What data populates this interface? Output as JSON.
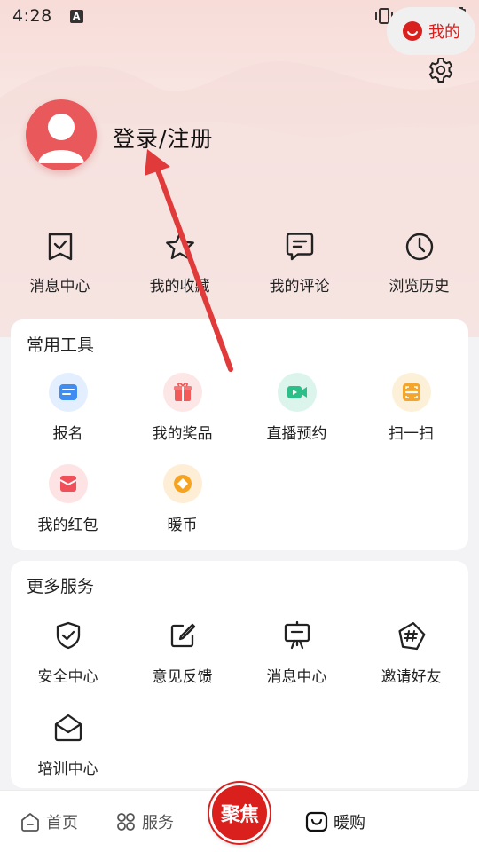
{
  "status": {
    "time": "4:28",
    "indicator": "A"
  },
  "profile": {
    "login_label": "登录/注册"
  },
  "quick": [
    {
      "label": "消息中心",
      "icon": "message-check-icon"
    },
    {
      "label": "我的收藏",
      "icon": "star-icon"
    },
    {
      "label": "我的评论",
      "icon": "comment-icon"
    },
    {
      "label": "浏览历史",
      "icon": "clock-icon"
    }
  ],
  "tools": {
    "title": "常用工具",
    "items": [
      {
        "label": "报名",
        "icon": "signup-icon",
        "color": "#3f8df0"
      },
      {
        "label": "我的奖品",
        "icon": "gift-icon",
        "color": "#f25a5a"
      },
      {
        "label": "直播预约",
        "icon": "video-icon",
        "color": "#2bbf8a"
      },
      {
        "label": "扫一扫",
        "icon": "scan-icon",
        "color": "#f4a52b"
      },
      {
        "label": "我的红包",
        "icon": "red-packet-icon",
        "color": "#f0505a"
      },
      {
        "label": "暖币",
        "icon": "coin-icon",
        "color": "#f6a321"
      }
    ]
  },
  "services": {
    "title": "更多服务",
    "items": [
      {
        "label": "安全中心",
        "icon": "shield-check-icon"
      },
      {
        "label": "意见反馈",
        "icon": "edit-icon"
      },
      {
        "label": "消息中心",
        "icon": "easel-icon"
      },
      {
        "label": "邀请好友",
        "icon": "hashtag-icon"
      },
      {
        "label": "培训中心",
        "icon": "envelope-open-icon"
      }
    ]
  },
  "nav": {
    "home": "首页",
    "services": "服务",
    "focus": "聚焦",
    "shop": "暖购",
    "mine": "我的"
  },
  "colors": {
    "brand_red": "#d9201d",
    "arrow": "#e03a3a"
  }
}
